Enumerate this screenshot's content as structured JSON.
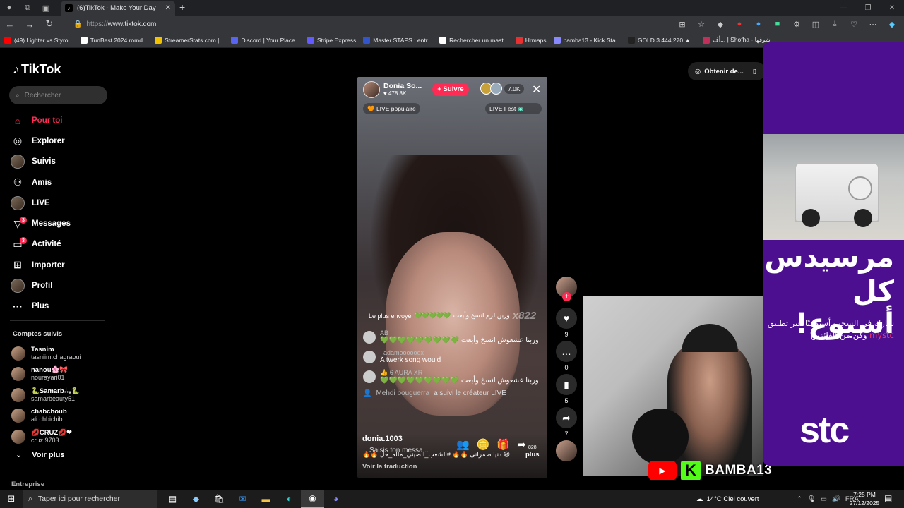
{
  "browser": {
    "tab_title": "(6)TikTok - Make Your Day",
    "url_proto": "https://",
    "url_host": "www.tiktok.com",
    "bookmarks": [
      {
        "label": "(49) Lighter vs Styro...",
        "color": "#ff0000"
      },
      {
        "label": "TunBest 2024 romd...",
        "color": "#ffffff"
      },
      {
        "label": "StreamerStats.com |...",
        "color": "#f2c200"
      },
      {
        "label": "Discord | Your Place...",
        "color": "#5865f2"
      },
      {
        "label": "Stripe Express",
        "color": "#635bff"
      },
      {
        "label": "Master STAPS : entr...",
        "color": "#3355cc"
      },
      {
        "label": "Rechercher un mast...",
        "color": "#ffffff"
      },
      {
        "label": "Hrmaps",
        "color": "#e83030"
      },
      {
        "label": "bamba13 - Kick Sta...",
        "color": "#8888ff"
      },
      {
        "label": "GOLD 3 444,270 ▲...",
        "color": "#222222"
      },
      {
        "label": "أف... | Shofha - شوفها",
        "color": "#c0305a"
      }
    ]
  },
  "sidebar": {
    "logo": "TikTok",
    "search_placeholder": "Rechercher",
    "nav": [
      {
        "label": "Pour toi",
        "icon": "home-icon",
        "glyph": "⌂",
        "active": true,
        "badge": ""
      },
      {
        "label": "Explorer",
        "icon": "compass-icon",
        "glyph": "◎",
        "active": false,
        "badge": ""
      },
      {
        "label": "Suivis",
        "icon": "following-icon",
        "glyph": "",
        "active": false,
        "badge": ""
      },
      {
        "label": "Amis",
        "icon": "friends-icon",
        "glyph": "⚇",
        "active": false,
        "badge": ""
      },
      {
        "label": "LIVE",
        "icon": "live-icon",
        "glyph": "",
        "active": false,
        "badge": ""
      },
      {
        "label": "Messages",
        "icon": "messages-icon",
        "glyph": "▽",
        "active": false,
        "badge": "3"
      },
      {
        "label": "Activité",
        "icon": "activity-icon",
        "glyph": "▭",
        "active": false,
        "badge": "3"
      },
      {
        "label": "Importer",
        "icon": "upload-icon",
        "glyph": "⊞",
        "active": false,
        "badge": ""
      },
      {
        "label": "Profil",
        "icon": "profile-icon",
        "glyph": "",
        "active": false,
        "badge": ""
      },
      {
        "label": "Plus",
        "icon": "more-icon",
        "glyph": "···",
        "active": false,
        "badge": ""
      }
    ],
    "followed_title": "Comptes suivis",
    "followed": [
      {
        "name": "Tasnim",
        "handle": "tasniim.chagraoui"
      },
      {
        "name": "nanou🌸🎀",
        "handle": "nourayari01"
      },
      {
        "name": "🐍Samarb𝆺𝅥𝆹ᵧ🐍",
        "handle": "samarbeauty51"
      },
      {
        "name": "chabchoub",
        "handle": "ali.chbichib"
      },
      {
        "name": "💋CRUZ💋❤",
        "handle": "cruz.9703"
      }
    ],
    "voir_plus": "Voir plus",
    "entreprise": "Entreprise"
  },
  "topbar": {
    "obtain_label": "Obtenir de..."
  },
  "live": {
    "host_name": "Donia So...",
    "host_likes": "♥ 478.8K",
    "follow_label": "+ Suivre",
    "viewer_count": "7.0K",
    "pill_popular": "🧡 LIVE populaire",
    "pill_fest": "LIVE Fest",
    "top_gift_label": "Le plus envoyé",
    "top_gift_text": "وربن لرم انسخ وأبعت",
    "top_gift_mult": "x822",
    "chat": [
      {
        "user": "AB",
        "text": "وربنا عشعوش انسخ وأبعت",
        "hearts": "💚💚💚💚💚💚💚💚💚"
      },
      {
        "user": "_adamoooooox",
        "text": "A twerk song would",
        "hearts": ""
      },
      {
        "user": "👍 6  AURA XR",
        "text": "وربنا عشعوش انسخ وأبعت",
        "hearts": "💚💚💚💚💚💚💚💚💚"
      }
    ],
    "system_msg_user": "Mehdi bouguerra",
    "system_msg_text": "a suivi le créateur LIVE",
    "desc_user": "donia.1003",
    "input_placeholder": "Saisis ton messa...",
    "description": "🔥🔥 دنيا صمرانى 🔥🔥 #الشعب_الصيني_ماله_حل 😆 ...",
    "more_label": "plus",
    "more_count": "828",
    "translate": "Voir la traduction"
  },
  "actions": [
    {
      "name": "like",
      "glyph": "♥",
      "count": "9"
    },
    {
      "name": "comment",
      "glyph": "…",
      "count": "0"
    },
    {
      "name": "bookmark",
      "glyph": "▮",
      "count": "5"
    },
    {
      "name": "share",
      "glyph": "➦",
      "count": "7"
    }
  ],
  "stream_overlay": {
    "channel": "BAMBA13",
    "kick_letter": "K"
  },
  "ad": {
    "line1": "مرسيدس",
    "line2": "كل أسبوع!",
    "body_1": "شارك في السحب أسبوعيًا عبر تطبيق",
    "brand_app": "mystc",
    "body_2": "وكن من الفائزين",
    "logo": "stc"
  },
  "taskbar": {
    "search_placeholder": "Taper ici pour rechercher",
    "weather": "14°C  Ciel couvert",
    "lang": "FRA",
    "time": "7:25 PM",
    "date": "27/12/2025"
  }
}
